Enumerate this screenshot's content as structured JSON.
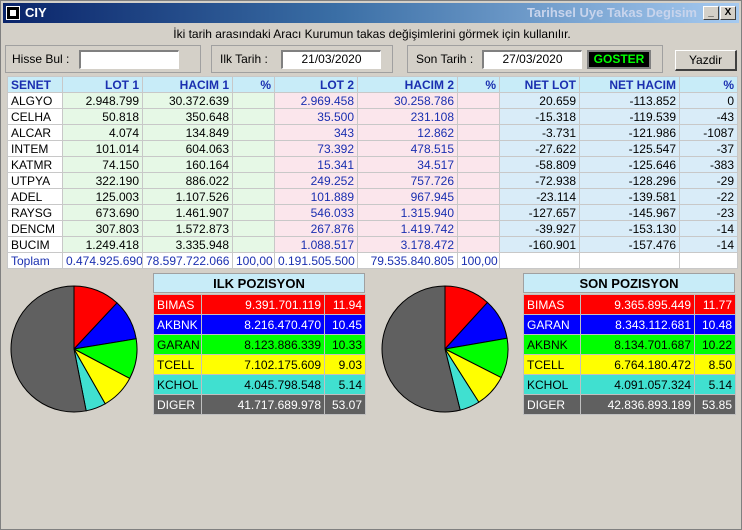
{
  "window": {
    "title": "CIY",
    "subtitle": "Tarihsel Uye Takas Degisim",
    "minimize_glyph": "_",
    "close_glyph": "X"
  },
  "instruction": "İki tarih arasındaki  Aracı Kurumun takas değişimlerini görmek için kullanılır.",
  "search": {
    "label": "Hisse Bul :",
    "value": ""
  },
  "start_date": {
    "label": "Ilk Tarih :",
    "value": "21/03/2020"
  },
  "end_date": {
    "label": "Son Tarih :",
    "value": "27/03/2020"
  },
  "buttons": {
    "show": "GOSTER",
    "print": "Yazdir"
  },
  "table": {
    "headers": [
      "SENET",
      "LOT 1",
      "HACIM 1",
      "%",
      "LOT 2",
      "HACIM 2",
      "%",
      "NET LOT",
      "NET HACIM",
      "%"
    ],
    "rows": [
      [
        "ALGYO",
        "2.948.799",
        "30.372.639",
        "",
        "2.969.458",
        "30.258.786",
        "",
        "20.659",
        "-113.852",
        "0"
      ],
      [
        "CELHA",
        "50.818",
        "350.648",
        "",
        "35.500",
        "231.108",
        "",
        "-15.318",
        "-119.539",
        "-43"
      ],
      [
        "ALCAR",
        "4.074",
        "134.849",
        "",
        "343",
        "12.862",
        "",
        "-3.731",
        "-121.986",
        "-1087"
      ],
      [
        "INTEM",
        "101.014",
        "604.063",
        "",
        "73.392",
        "478.515",
        "",
        "-27.622",
        "-125.547",
        "-37"
      ],
      [
        "KATMR",
        "74.150",
        "160.164",
        "",
        "15.341",
        "34.517",
        "",
        "-58.809",
        "-125.646",
        "-383"
      ],
      [
        "UTPYA",
        "322.190",
        "886.022",
        "",
        "249.252",
        "757.726",
        "",
        "-72.938",
        "-128.296",
        "-29"
      ],
      [
        "ADEL",
        "125.003",
        "1.107.526",
        "",
        "101.889",
        "967.945",
        "",
        "-23.114",
        "-139.581",
        "-22"
      ],
      [
        "RAYSG",
        "673.690",
        "1.461.907",
        "",
        "546.033",
        "1.315.940",
        "",
        "-127.657",
        "-145.967",
        "-23"
      ],
      [
        "DENCM",
        "307.803",
        "1.572.873",
        "",
        "267.876",
        "1.419.742",
        "",
        "-39.927",
        "-153.130",
        "-14"
      ],
      [
        "BUCIM",
        "1.249.418",
        "3.335.948",
        "",
        "1.088.517",
        "3.178.472",
        "",
        "-160.901",
        "-157.476",
        "-14"
      ]
    ],
    "total": [
      "Toplam",
      "0.474.925.690",
      "78.597.722.066",
      "100,00",
      "0.191.505.500",
      "79.535.840.805",
      "100,00",
      "",
      "",
      ""
    ]
  },
  "first_position": {
    "title": "ILK POZISYON",
    "rows": [
      {
        "code": "BIMAS",
        "amount": "9.391.701.119",
        "pct": "11.94",
        "bg": "#ff0000",
        "fg": "#ffffff"
      },
      {
        "code": "AKBNK",
        "amount": "8.216.470.470",
        "pct": "10.45",
        "bg": "#0000ff",
        "fg": "#ffffff"
      },
      {
        "code": "GARAN",
        "amount": "8.123.886.339",
        "pct": "10.33",
        "bg": "#00ff00",
        "fg": "#000000"
      },
      {
        "code": "TCELL",
        "amount": "7.102.175.609",
        "pct": "9.03",
        "bg": "#ffff00",
        "fg": "#000000"
      },
      {
        "code": "KCHOL",
        "amount": "4.045.798.548",
        "pct": "5.14",
        "bg": "#40e0d0",
        "fg": "#000000"
      },
      {
        "code": "DIGER",
        "amount": "41.717.689.978",
        "pct": "53.07",
        "bg": "#606060",
        "fg": "#ffffff"
      }
    ],
    "pie_values": [
      11.94,
      10.45,
      10.33,
      9.03,
      5.14,
      53.07
    ]
  },
  "last_position": {
    "title": "SON POZISYON",
    "rows": [
      {
        "code": "BIMAS",
        "amount": "9.365.895.449",
        "pct": "11.77",
        "bg": "#ff0000",
        "fg": "#ffffff"
      },
      {
        "code": "GARAN",
        "amount": "8.343.112.681",
        "pct": "10.48",
        "bg": "#0000ff",
        "fg": "#ffffff"
      },
      {
        "code": "AKBNK",
        "amount": "8.134.701.687",
        "pct": "10.22",
        "bg": "#00ff00",
        "fg": "#000000"
      },
      {
        "code": "TCELL",
        "amount": "6.764.180.472",
        "pct": "8.50",
        "bg": "#ffff00",
        "fg": "#000000"
      },
      {
        "code": "KCHOL",
        "amount": "4.091.057.324",
        "pct": "5.14",
        "bg": "#40e0d0",
        "fg": "#000000"
      },
      {
        "code": "DIGER",
        "amount": "42.836.893.189",
        "pct": "53.85",
        "bg": "#606060",
        "fg": "#ffffff"
      }
    ],
    "pie_values": [
      11.77,
      10.48,
      10.22,
      8.5,
      5.14,
      53.85
    ]
  }
}
